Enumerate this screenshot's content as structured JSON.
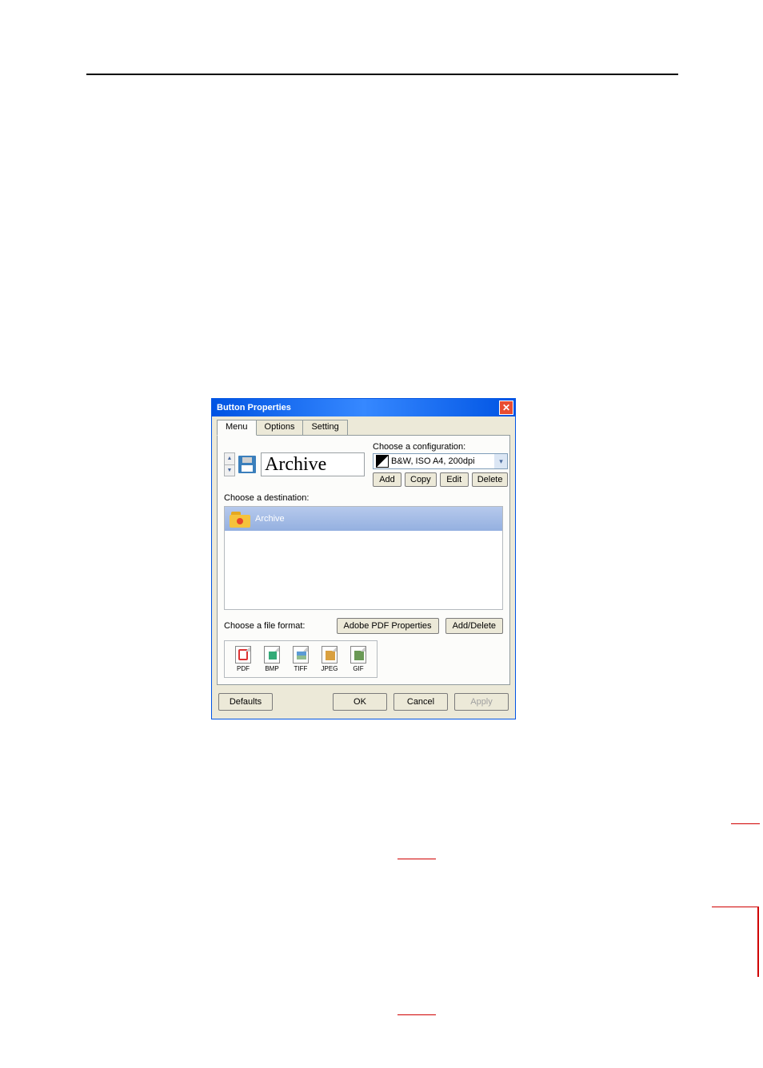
{
  "titlebar": {
    "text": "Button Properties"
  },
  "tabs": {
    "menu": "Menu",
    "options": "Options",
    "setting": "Setting"
  },
  "main_title": "Archive",
  "config": {
    "label": "Choose a configuration:",
    "selected": "B&W, ISO A4, 200dpi",
    "buttons": {
      "add": "Add",
      "copy": "Copy",
      "edit": "Edit",
      "delete": "Delete"
    }
  },
  "destination": {
    "label": "Choose a destination:",
    "item": "Archive"
  },
  "file_format": {
    "label": "Choose a file format:",
    "pdf_props": "Adobe PDF Properties",
    "add_delete": "Add/Delete",
    "formats": {
      "pdf": "PDF",
      "bmp": "BMP",
      "tiff": "TIFF",
      "jpeg": "JPEG",
      "gif": "GIF"
    }
  },
  "bottom": {
    "defaults": "Defaults",
    "ok": "OK",
    "cancel": "Cancel",
    "apply": "Apply"
  }
}
